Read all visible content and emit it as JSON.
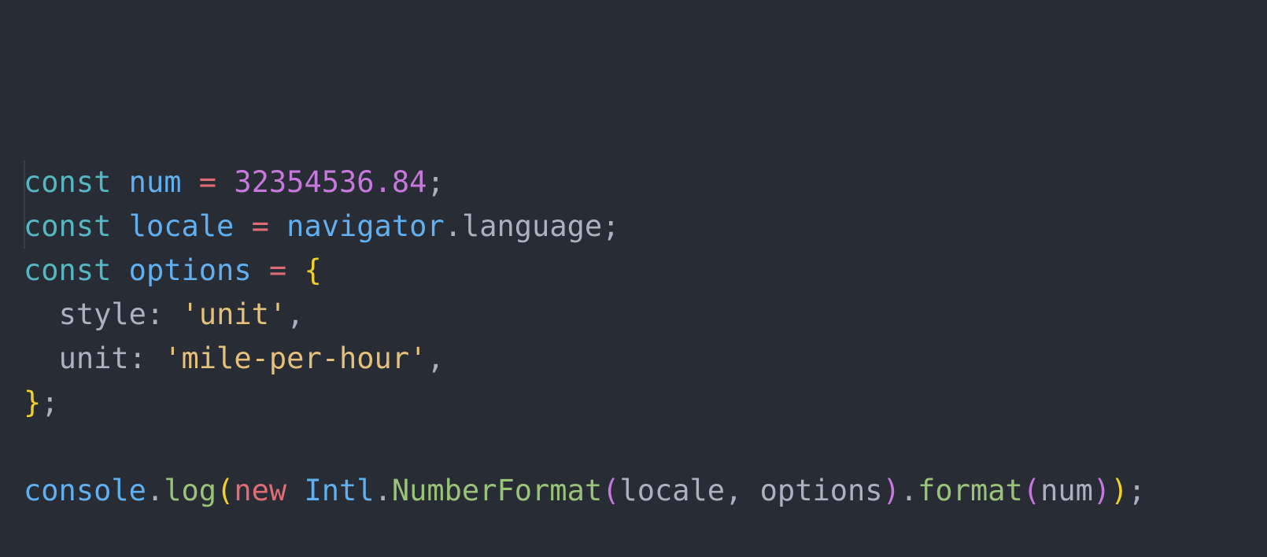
{
  "code": {
    "lines": [
      [
        {
          "t": "const",
          "k": "keyword"
        },
        {
          "t": " "
        },
        {
          "t": "num",
          "k": "var"
        },
        {
          "t": " "
        },
        {
          "t": "=",
          "k": "op"
        },
        {
          "t": " "
        },
        {
          "t": "32354536.84",
          "k": "num"
        },
        {
          "t": ";",
          "k": "punct"
        }
      ],
      [
        {
          "t": "const",
          "k": "keyword"
        },
        {
          "t": " "
        },
        {
          "t": "locale",
          "k": "var"
        },
        {
          "t": " "
        },
        {
          "t": "=",
          "k": "op"
        },
        {
          "t": " "
        },
        {
          "t": "navigator",
          "k": "var"
        },
        {
          "t": ".",
          "k": "punct"
        },
        {
          "t": "language",
          "k": "prop"
        },
        {
          "t": ";",
          "k": "punct"
        }
      ],
      [
        {
          "t": "const",
          "k": "keyword"
        },
        {
          "t": " "
        },
        {
          "t": "options",
          "k": "var"
        },
        {
          "t": " "
        },
        {
          "t": "=",
          "k": "op"
        },
        {
          "t": " "
        },
        {
          "t": "{",
          "k": "brace"
        }
      ],
      [
        {
          "t": "  "
        },
        {
          "t": "style",
          "k": "prop"
        },
        {
          "t": ": ",
          "k": "punct"
        },
        {
          "t": "'unit'",
          "k": "string"
        },
        {
          "t": ",",
          "k": "punct"
        }
      ],
      [
        {
          "t": "  "
        },
        {
          "t": "unit",
          "k": "prop"
        },
        {
          "t": ": ",
          "k": "punct"
        },
        {
          "t": "'mile-per-hour'",
          "k": "string"
        },
        {
          "t": ",",
          "k": "punct"
        }
      ],
      [
        {
          "t": "}",
          "k": "brace"
        },
        {
          "t": ";",
          "k": "punct"
        }
      ],
      [],
      [
        {
          "t": "console",
          "k": "var"
        },
        {
          "t": ".",
          "k": "punct"
        },
        {
          "t": "log",
          "k": "fn"
        },
        {
          "t": "(",
          "k": "paren1"
        },
        {
          "t": "new",
          "k": "new"
        },
        {
          "t": " "
        },
        {
          "t": "Intl",
          "k": "class"
        },
        {
          "t": ".",
          "k": "punct"
        },
        {
          "t": "NumberFormat",
          "k": "fn"
        },
        {
          "t": "(",
          "k": "paren2"
        },
        {
          "t": "locale",
          "k": "ident"
        },
        {
          "t": ", ",
          "k": "punct"
        },
        {
          "t": "options",
          "k": "ident"
        },
        {
          "t": ")",
          "k": "paren2"
        },
        {
          "t": ".",
          "k": "punct"
        },
        {
          "t": "format",
          "k": "fn"
        },
        {
          "t": "(",
          "k": "paren2"
        },
        {
          "t": "num",
          "k": "ident"
        },
        {
          "t": ")",
          "k": "paren2"
        },
        {
          "t": ")",
          "k": "paren1"
        },
        {
          "t": ";",
          "k": "punct"
        }
      ]
    ]
  },
  "colors": {
    "background": "#282c34",
    "keyword": "#56b6c2",
    "variable": "#61afef",
    "operator": "#e06c75",
    "number": "#c678dd",
    "string": "#e5c07b",
    "brace": "#f1d02d",
    "function": "#98c379",
    "text": "#abb2bf"
  }
}
